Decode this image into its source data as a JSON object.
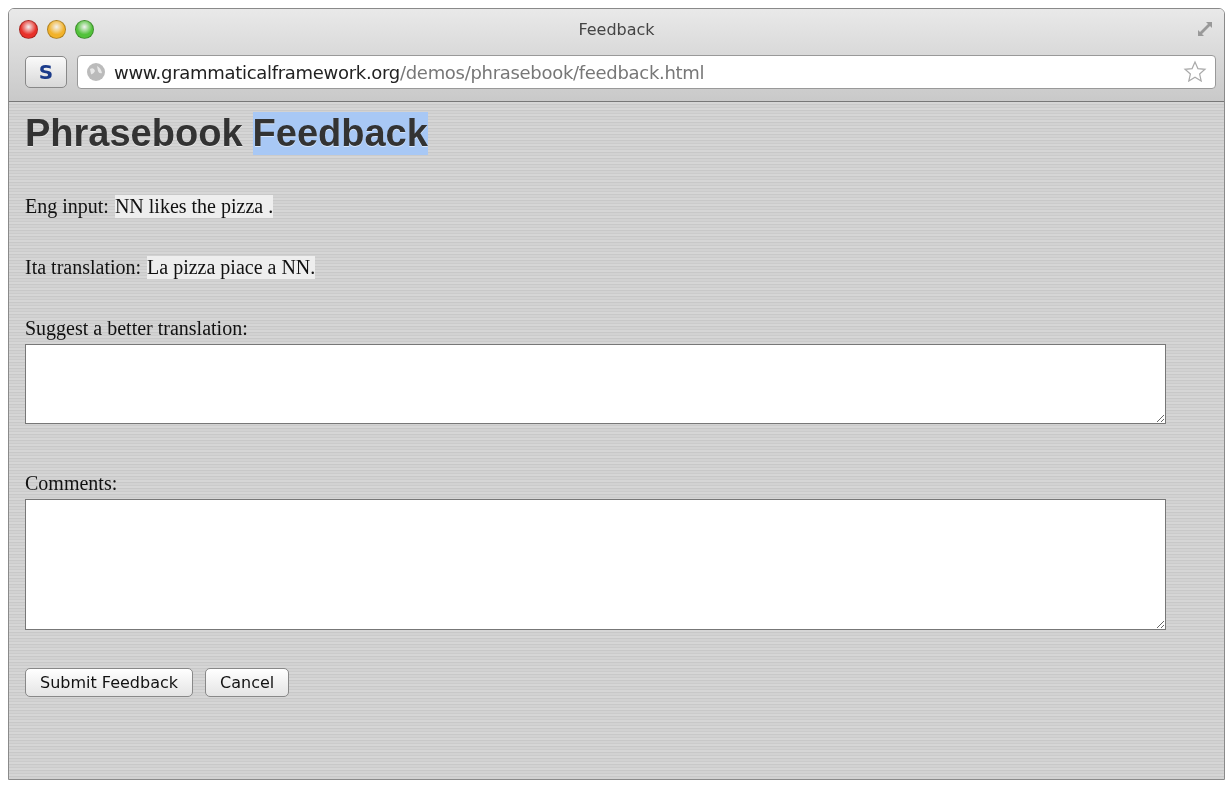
{
  "window": {
    "title": "Feedback"
  },
  "toolbar": {
    "extension_button": "S",
    "url": {
      "host": "www.grammaticalframework.org",
      "path": "/demos/phrasebook/feedback.html"
    }
  },
  "page": {
    "heading": [
      {
        "text": "Phrasebook",
        "selected": false
      },
      {
        "text": "Feedback",
        "selected": true
      }
    ],
    "info_lines": [
      {
        "label": "Eng input:",
        "value": "NN likes the pizza ."
      },
      {
        "label": "Ita translation:",
        "value": "La pizza piace a NN."
      }
    ],
    "fields": [
      {
        "label": "Suggest a better translation:",
        "kind": "short"
      },
      {
        "label": "Comments:",
        "kind": "tall"
      }
    ],
    "buttons": [
      "Submit Feedback",
      "Cancel"
    ]
  }
}
